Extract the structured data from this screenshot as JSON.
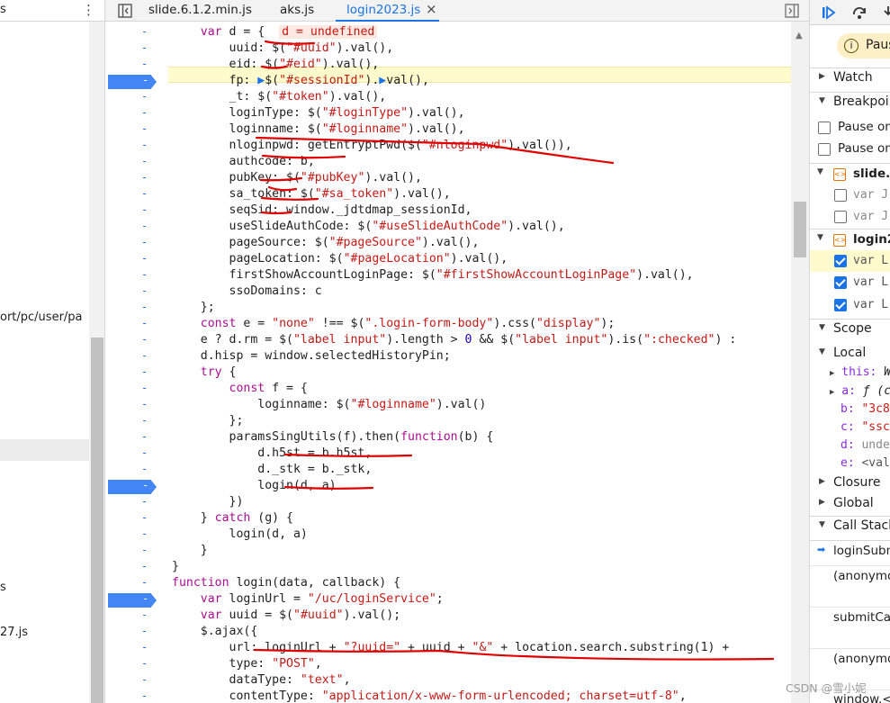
{
  "left_pane": {
    "title_fragment": "s",
    "rows": [
      "ort/pc/user/pa",
      "s",
      "27.js"
    ]
  },
  "tabs": [
    {
      "label": "slide.6.1.2.min.js",
      "active": false
    },
    {
      "label": "aks.js",
      "active": false
    },
    {
      "label": "login2023.js",
      "active": true,
      "close": "×"
    }
  ],
  "gutter_dash": "-",
  "code_lines": [
    "    var d = {  d = undefined",
    "        uuid: $(\"#uuid\").val(),",
    "        eid: $(\"#eid\").val(),",
    "        fp: ▶$(\"#sessionId\").▶val(),",
    "        _t: $(\"#token\").val(),",
    "        loginType: $(\"#loginType\").val(),",
    "        loginname: $(\"#loginname\").val(),",
    "        nloginpwd: getEntryptPwd($(\"#nloginpwd\").val()),",
    "        authcode: b,",
    "        pubKey: $(\"#pubKey\").val(),",
    "        sa_token: $(\"#sa_token\").val(),",
    "        seqSid: window._jdtdmap_sessionId,",
    "        useSlideAuthCode: $(\"#useSlideAuthCode\").val(),",
    "        pageSource: $(\"#pageSource\").val(),",
    "        pageLocation: $(\"#pageLocation\").val(),",
    "        firstShowAccountLoginPage: $(\"#firstShowAccountLoginPage\").val(),",
    "        ssoDomains: c",
    "    };",
    "    const e = \"none\" !== $(\".login-form-body\").css(\"display\");",
    "    e ? d.rm = $(\"label input\").length > 0 && $(\"label input\").is(\":checked\") :",
    "    d.hisp = window.selectedHistoryPin;",
    "    try {",
    "        const f = {",
    "            loginname: $(\"#loginname\").val()",
    "        };",
    "        paramsSingUtils(f).then(function(b) {",
    "            d.h5st = b.h5st,",
    "            d._stk = b._stk,",
    "            login(d, a)",
    "        })",
    "    } catch (g) {",
    "        login(d, a)",
    "    }",
    "}",
    "function login(data, callback) {",
    "    var loginUrl = \"/uc/loginService\";",
    "    var uuid = $(\"#uuid\").val();",
    "    $.ajax({",
    "        url: loginUrl + \"?uuid=\" + uuid + \"&\" + location.search.substring(1) +",
    "        type: \"POST\",",
    "        dataType: \"text\",",
    "        contentType: \"application/x-www-form-urlencoded; charset=utf-8\","
  ],
  "right_pane": {
    "paused_label": "Paus",
    "pause_icon": "i",
    "sections": {
      "watch": "Watch",
      "breakpoints": "Breakpoi",
      "scope": "Scope",
      "local": "Local",
      "closure": "Closure",
      "global": "Global",
      "call_stack": "Call Stack"
    },
    "pause_options": [
      "Pause on",
      "Pause on"
    ],
    "files": [
      {
        "name": "slide.6",
        "items": [
          "var J",
          "var J"
        ],
        "checked": [
          false,
          false
        ]
      },
      {
        "name": "login2",
        "items": [
          "var L",
          "var L",
          "var L"
        ],
        "checked": [
          true,
          true,
          true
        ]
      }
    ],
    "scope_vars": [
      {
        "key": "this:",
        "val": "W"
      },
      {
        "key": "a:",
        "val": "ƒ (c"
      },
      {
        "key": "b:",
        "val": "\"3c8"
      },
      {
        "key": "c:",
        "val": "\"ssc"
      },
      {
        "key": "d:",
        "val": "unde"
      },
      {
        "key": "e:",
        "val": "<val"
      }
    ],
    "call_stack": [
      "loginSubm",
      "(anonymo",
      "submitCal",
      "(anonymo",
      "window.<"
    ]
  },
  "watermark": "CSDN @雪小妮",
  "colors": {
    "accent": "#1a73e8",
    "highlight": "#fffbcc",
    "breakpoint": "#4285f4",
    "annotation": "#e00000"
  }
}
